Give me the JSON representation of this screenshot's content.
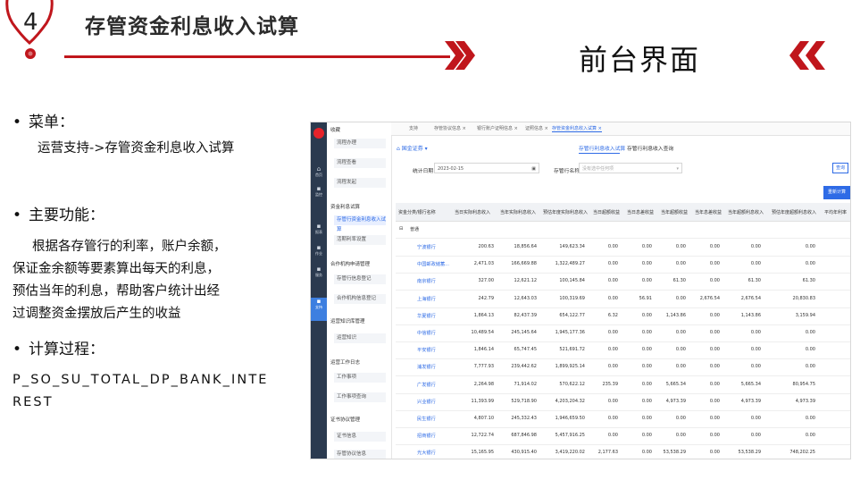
{
  "header": {
    "badge_number": "4",
    "title": "存管资金利息收入试算",
    "subtitle": "前台界面"
  },
  "sections": {
    "menu_label": "菜单：",
    "menu_path": "运营支持->存管资金利息收入试算",
    "function_label": "主要功能：",
    "function_lines": [
      "根据各存管行的利率，账户余额，",
      "保证金余额等要素算出每天的利息，",
      "预估当年的利息，帮助客户统计出经",
      "过调整资金摆放后产生的收益"
    ],
    "calc_label": "计算过程：",
    "calc_lines": [
      "P_SO_SU_TOTAL_DP_BANK_INTE",
      "REST"
    ]
  },
  "screenshot": {
    "rail_items": [
      "首页",
      "监控",
      "报表",
      "作业",
      "服务",
      "支持"
    ],
    "menu_groups": [
      {
        "head": "收藏",
        "items": [
          "流程办理",
          "流程查看",
          "流程发起"
        ]
      },
      {
        "head": "资金利息试算",
        "items": [
          "存管行资金利息收入试算",
          "活期利率设置"
        ]
      },
      {
        "head": "合作机构申请管理",
        "items": [
          "存管行信息登记",
          "合作机构信息登记"
        ]
      },
      {
        "head": "运营知识库管理",
        "items": [
          "运营知识"
        ]
      },
      {
        "head": "运营工作日志",
        "items": [
          "工作事项",
          "工作事项查询"
        ]
      },
      {
        "head": "证书协议管理",
        "items": [
          "证书信息",
          "存管协议信息"
        ]
      }
    ],
    "tabs": [
      "支持",
      "存管协议信息 ×",
      "银行账户证明信息 ×",
      "证照信息 ×",
      "存管资金利息收入试算 ×"
    ],
    "breadcrumb": "国金证券",
    "subtabs": [
      "存管行利息收入试算",
      "存管行利息收入查询"
    ],
    "filters": {
      "date_label": "统计日期",
      "date_value": "2023-02-15",
      "bank_label": "存管行名称",
      "bank_placeholder": "没有选中任何项"
    },
    "query_button": "查询",
    "recalc_button": "重新计算",
    "columns": [
      "资金分类/银行名称",
      "当日实际利息收入",
      "当年实际利息收入",
      "预估年度实际利息收入",
      "当日超额收益",
      "当日息差收益",
      "当年超额收益",
      "当年息差收益",
      "当年超额利息收入",
      "预估年度超额利息收入",
      "平均年利率"
    ],
    "group_label": "普通",
    "rows": [
      [
        "宁波银行",
        "200.63",
        "18,856.64",
        "149,623.34",
        "0.00",
        "0.00",
        "0.00",
        "0.00",
        "0.00",
        "0.00"
      ],
      [
        "中国邮政储蓄...",
        "2,471.03",
        "166,669.88",
        "1,322,489.27",
        "0.00",
        "0.00",
        "0.00",
        "0.00",
        "0.00",
        "0.00"
      ],
      [
        "南京银行",
        "327.00",
        "12,621.12",
        "100,145.84",
        "0.00",
        "0.00",
        "61.30",
        "0.00",
        "61.30",
        "61.30"
      ],
      [
        "上海银行",
        "242.79",
        "12,643.03",
        "100,319.69",
        "0.00",
        "56.91",
        "0.00",
        "2,676.54",
        "2,676.54",
        "20,830.83"
      ],
      [
        "华夏银行",
        "1,864.13",
        "82,437.39",
        "654,122.77",
        "6.32",
        "0.00",
        "1,143.86",
        "0.00",
        "1,143.86",
        "3,159.94"
      ],
      [
        "中信银行",
        "10,489.54",
        "245,145.64",
        "1,945,177.36",
        "0.00",
        "0.00",
        "0.00",
        "0.00",
        "0.00",
        "0.00"
      ],
      [
        "平安银行",
        "1,846.14",
        "65,747.45",
        "521,691.72",
        "0.00",
        "0.00",
        "0.00",
        "0.00",
        "0.00",
        "0.00"
      ],
      [
        "浦发银行",
        "7,777.93",
        "239,442.62",
        "1,899,925.14",
        "0.00",
        "0.00",
        "0.00",
        "0.00",
        "0.00",
        "0.00"
      ],
      [
        "广发银行",
        "2,264.98",
        "71,914.02",
        "570,622.12",
        "235.39",
        "0.00",
        "5,665.34",
        "0.00",
        "5,665.34",
        "80,954.75"
      ],
      [
        "兴业银行",
        "11,393.99",
        "529,718.90",
        "4,203,204.32",
        "0.00",
        "0.00",
        "4,973.39",
        "0.00",
        "4,973.39",
        "4,973.39"
      ],
      [
        "民生银行",
        "4,807.10",
        "245,332.43",
        "1,946,659.50",
        "0.00",
        "0.00",
        "0.00",
        "0.00",
        "0.00",
        "0.00"
      ],
      [
        "招商银行",
        "12,722.74",
        "687,846.98",
        "5,457,916.25",
        "0.00",
        "0.00",
        "0.00",
        "0.00",
        "0.00",
        "0.00"
      ],
      [
        "光大银行",
        "15,165.95",
        "430,915.40",
        "3,419,220.02",
        "2,177.63",
        "0.00",
        "53,538.29",
        "0.00",
        "53,538.29",
        "748,202.25"
      ]
    ]
  },
  "colors": {
    "accent_red": "#c0161c",
    "link_blue": "#2e6be6",
    "rail_dark": "#2b3a4f"
  }
}
